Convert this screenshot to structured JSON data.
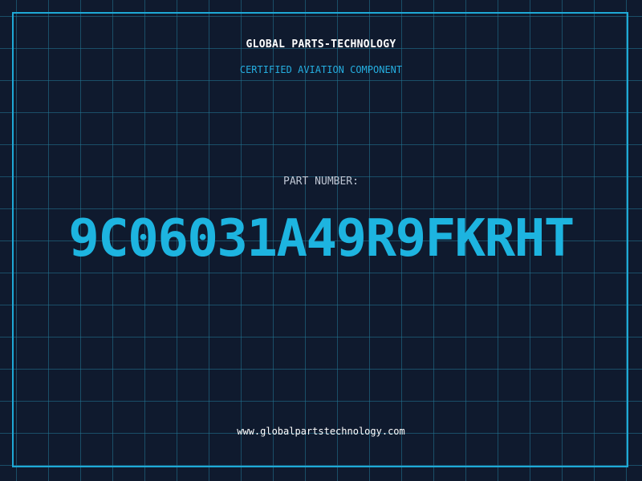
{
  "header": {
    "company": "GLOBAL PARTS-TECHNOLOGY",
    "tagline": "CERTIFIED AVIATION COMPONENT"
  },
  "part": {
    "label": "PART NUMBER:",
    "number": "9C06031A49R9FKRHT"
  },
  "footer": {
    "website": "www.globalpartstechnology.com"
  },
  "colors": {
    "background": "#0f1a2e",
    "grid": "#22788f",
    "accent": "#1db4e0",
    "text": "#ffffff"
  }
}
